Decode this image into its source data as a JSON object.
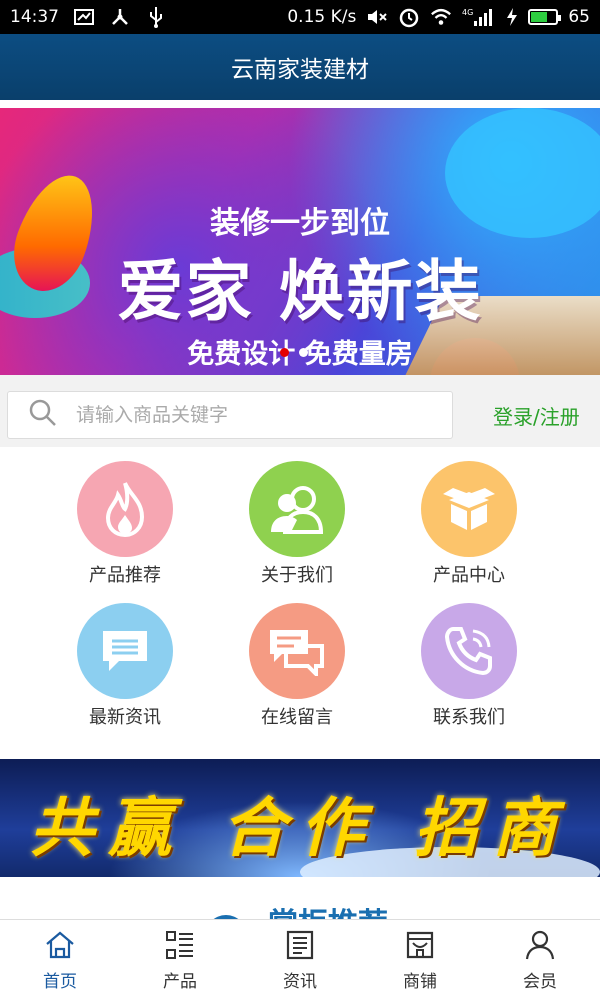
{
  "status_bar": {
    "time": "14:37",
    "network_speed": "0.15 K/s",
    "signal_type": "4G",
    "battery": "65",
    "battery_level": 0.65,
    "icons": [
      "screen-icon",
      "usb-debug-icon",
      "usb-icon",
      "mute-icon",
      "alarm-icon",
      "wifi-icon",
      "signal-icon",
      "charging-icon",
      "battery-icon"
    ]
  },
  "header": {
    "title": "云南家装建材"
  },
  "banner": {
    "subtitle": "装修一步到位",
    "headline": "爱家 焕新装",
    "tagline": "免费设计 免费量房",
    "slide_count": 2,
    "active_slide": 1
  },
  "search": {
    "placeholder": "请输入商品关键字",
    "value": "",
    "login_label": "登录/注册"
  },
  "menu": {
    "items": [
      {
        "label": "产品推荐",
        "icon": "flame-icon",
        "color": "#f6a6b2"
      },
      {
        "label": "关于我们",
        "icon": "users-icon",
        "color": "#8fd14f"
      },
      {
        "label": "产品中心",
        "icon": "box-icon",
        "color": "#fcc46b"
      },
      {
        "label": "最新资讯",
        "icon": "message-icon",
        "color": "#8ccff0"
      },
      {
        "label": "在线留言",
        "icon": "chat-icon",
        "color": "#f59b83"
      },
      {
        "label": "联系我们",
        "icon": "phone-icon",
        "color": "#c8a8e8"
      }
    ]
  },
  "ad_banner": {
    "text": "共赢 合作 招商"
  },
  "section": {
    "title": "掌柜推荐"
  },
  "tabbar": {
    "items": [
      {
        "label": "首页",
        "icon": "home-icon",
        "active": true
      },
      {
        "label": "产品",
        "icon": "grid-list-icon",
        "active": false
      },
      {
        "label": "资讯",
        "icon": "news-icon",
        "active": false
      },
      {
        "label": "商铺",
        "icon": "shop-icon",
        "active": false
      },
      {
        "label": "会员",
        "icon": "user-icon",
        "active": false
      }
    ]
  },
  "colors": {
    "header_bg": "#0c4d82",
    "login_link": "#2aa12a",
    "tab_active": "#1a5aa0",
    "section_title": "#1a6fb0"
  }
}
